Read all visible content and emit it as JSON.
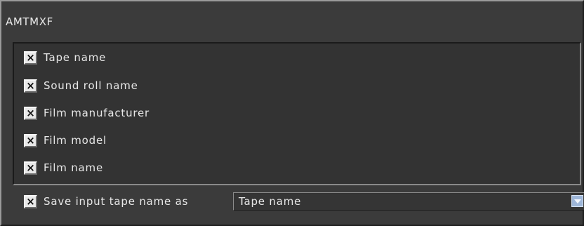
{
  "panel": {
    "title": "AMTMXF"
  },
  "checkbox_mark": "×",
  "items": [
    {
      "label": "Tape name",
      "checked": true
    },
    {
      "label": "Sound roll name",
      "checked": true
    },
    {
      "label": "Film manufacturer",
      "checked": true
    },
    {
      "label": "Film model",
      "checked": true
    },
    {
      "label": "Film name",
      "checked": true
    }
  ],
  "save_option": {
    "label": "Save input tape name as",
    "checked": true,
    "selected_value": "Tape name"
  },
  "colors": {
    "background": "#3b3b3b",
    "text": "#e8e8e8",
    "dropdown_arrow": "#9fb7d9"
  }
}
